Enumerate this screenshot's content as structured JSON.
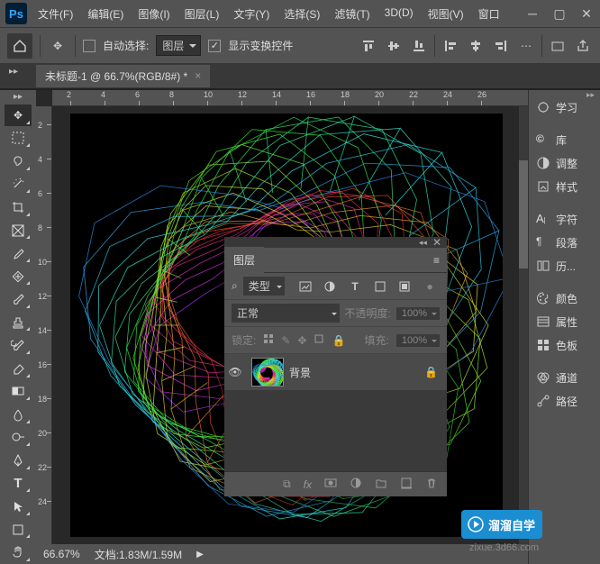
{
  "menu": {
    "items": [
      "文件(F)",
      "编辑(E)",
      "图像(I)",
      "图层(L)",
      "文字(Y)",
      "选择(S)",
      "滤镜(T)",
      "3D(D)",
      "视图(V)",
      "窗口"
    ]
  },
  "optbar": {
    "auto_select_label": "自动选择:",
    "auto_select_value": "图层",
    "show_transform_label": "显示变换控件"
  },
  "doc_tab": {
    "title": "未标题-1 @ 66.7%(RGB/8#) *"
  },
  "ruler_h": [
    "2",
    "4",
    "6",
    "8",
    "10",
    "12",
    "14",
    "16",
    "18",
    "20",
    "22",
    "24",
    "26"
  ],
  "ruler_v": [
    "2",
    "4",
    "6",
    "8",
    "10",
    "12",
    "14",
    "16",
    "18",
    "20",
    "22",
    "24"
  ],
  "status": {
    "zoom": "66.67%",
    "doc_info": "文档:1.83M/1.59M"
  },
  "right_panel": {
    "items": [
      {
        "name": "learn",
        "label": "学习",
        "icon": "bulb"
      },
      {
        "name": "libraries",
        "label": "库",
        "icon": "cc"
      },
      {
        "name": "adjustments",
        "label": "调整",
        "icon": "circle-half"
      },
      {
        "name": "styles",
        "label": "样式",
        "icon": "fx-box"
      },
      {
        "name": "character",
        "label": "字符",
        "icon": "A|"
      },
      {
        "name": "paragraph",
        "label": "段落",
        "icon": "para"
      },
      {
        "name": "history",
        "label": "历...",
        "icon": "history"
      },
      {
        "name": "color",
        "label": "颜色",
        "icon": "palette"
      },
      {
        "name": "properties",
        "label": "属性",
        "icon": "props"
      },
      {
        "name": "swatches",
        "label": "色板",
        "icon": "swatches"
      },
      {
        "name": "channels",
        "label": "通道",
        "icon": "channels"
      },
      {
        "name": "paths",
        "label": "路径",
        "icon": "paths"
      }
    ]
  },
  "layers_panel": {
    "tab_label": "图层",
    "filter_label": "类型",
    "blend_mode": "正常",
    "opacity_label": "不透明度:",
    "opacity_value": "100%",
    "lock_label": "锁定:",
    "fill_label": "填充:",
    "fill_value": "100%",
    "layer": {
      "name": "背景"
    }
  },
  "watermark": {
    "brand": "溜溜自学",
    "url": "zixue.3d66.com"
  }
}
